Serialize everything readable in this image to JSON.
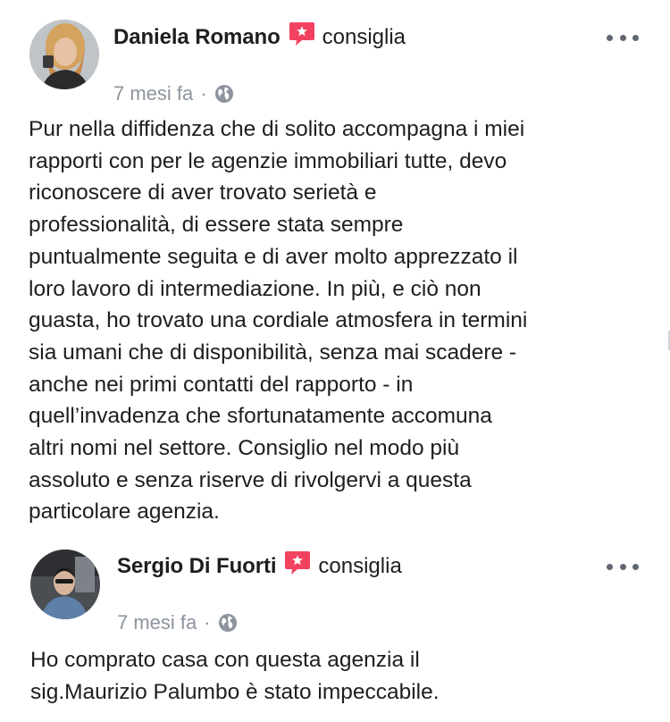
{
  "reviews": [
    {
      "author": "Daniela Romano",
      "action": "consiglia",
      "time": "7 mesi fa",
      "separator": "·",
      "text_lines": [
        "Pur nella diffidenza che di solito accompagna i miei",
        "rapporti con per le agenzie immobiliari tutte, devo",
        "riconoscere di aver trovato serietà e",
        "professionalità, di essere stata sempre",
        "puntualmente seguita e di aver molto apprezzato il",
        "loro lavoro di intermediazione. In più, e ciò non",
        "guasta, ho trovato una cordiale atmosfera in termini",
        "sia umani che di disponibilità, senza mai scadere -",
        "anche nei primi contatti del rapporto - in",
        "quell’invadenza che sfortunatamente accomuna",
        "altri nomi nel settore. Consiglio nel modo più",
        "assoluto e senza riserve di rivolgervi a questa",
        "particolare agenzia."
      ]
    },
    {
      "author": "Sergio Di Fuorti",
      "action": "consiglia",
      "time": "7 mesi fa",
      "separator": "·",
      "text_lines": [
        "Ho comprato casa con questa agenzia il",
        "sig.Maurizio Palumbo è stato impeccabile."
      ]
    }
  ],
  "icons": {
    "recommend": "recommend-icon",
    "privacy": "globe-icon",
    "more": "more-options-icon"
  },
  "colors": {
    "recommend_red": "#f3425f",
    "meta_gray": "#8d949e",
    "text": "#1c1e21"
  }
}
